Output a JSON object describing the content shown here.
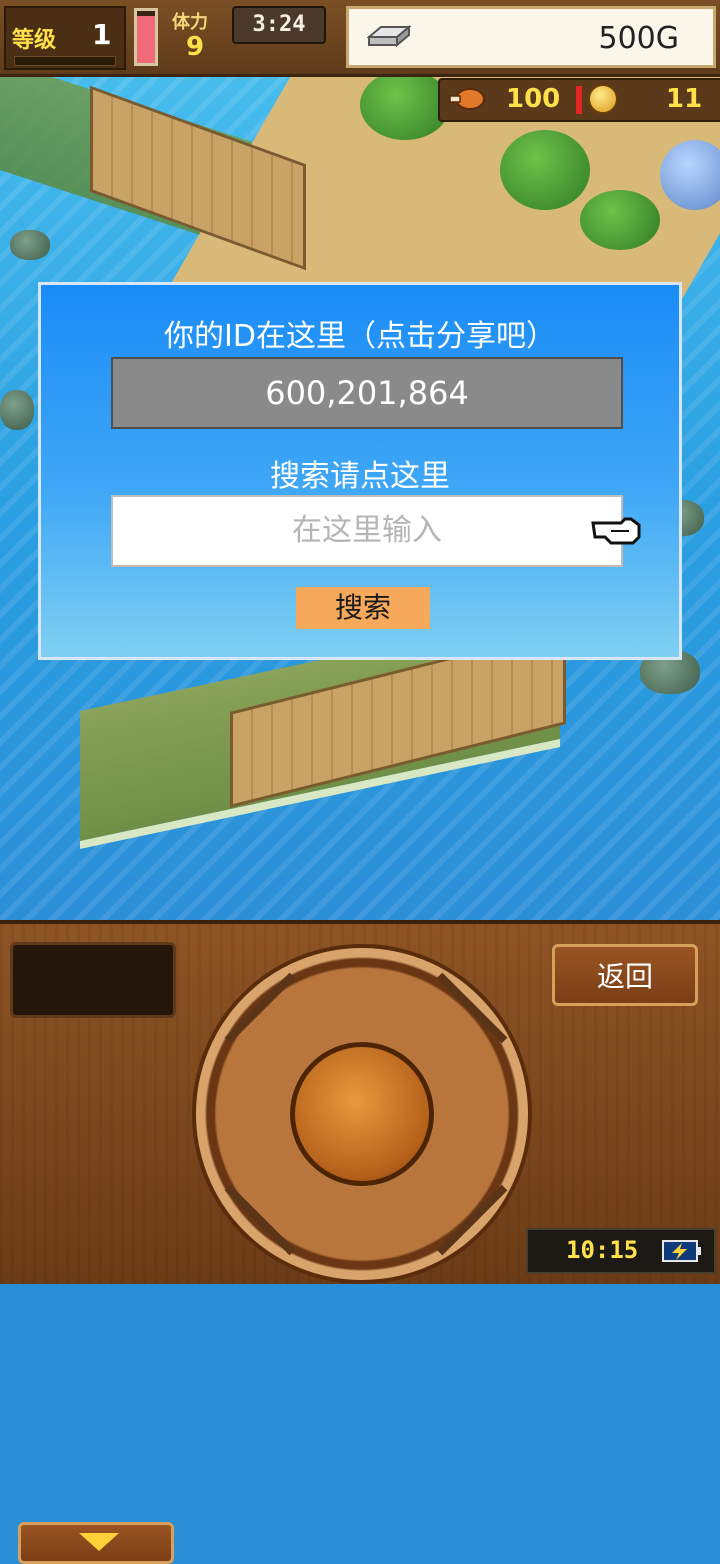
{
  "hud": {
    "level_label": "等级",
    "level": "1",
    "hp_level_percent": 90,
    "stamina_label": "体力",
    "stamina": "9",
    "clock": "3:24",
    "gold": "500G",
    "food": "100",
    "coins": "11"
  },
  "dialog": {
    "title": "你的ID在这里（点击分享吧）",
    "player_id": "600,201,864",
    "search_prompt": "搜索请点这里",
    "search_placeholder": "在这里输入",
    "search_button": "搜索"
  },
  "panel": {
    "back_button": "返回",
    "system_time": "10:15"
  },
  "colors": {
    "dialog_top": "#1a8cf7",
    "search_button": "#f6a95a",
    "water": "#2a9fe2"
  }
}
